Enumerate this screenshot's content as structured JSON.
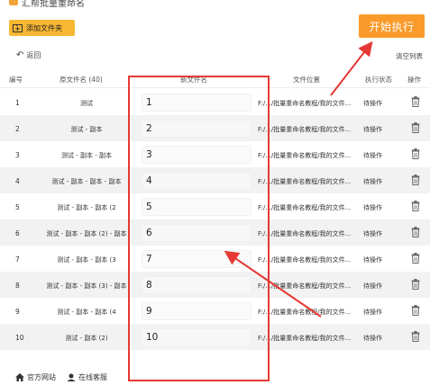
{
  "window": {
    "title": "汇帮批量重命名"
  },
  "toolbar": {
    "add_folder_label": "添加文件夹",
    "start_label": "开始执行"
  },
  "actions": {
    "undo_label": "返回",
    "clear_label": "清空列表"
  },
  "table": {
    "headers": {
      "num": "编号",
      "filename": "原文件名 (40)",
      "newname": "新文件名",
      "location": "文件位置",
      "status": "执行状态",
      "op": "操作"
    },
    "rows": [
      {
        "num": "1",
        "filename": "测试",
        "newname": "1",
        "location": "F:/.../批量重命名教程/我的文件...",
        "status": "待操作"
      },
      {
        "num": "2",
        "filename": "测试 - 副本",
        "newname": "2",
        "location": "F:/.../批量重命名教程/我的文件...",
        "status": "待操作"
      },
      {
        "num": "3",
        "filename": "测试 - 副本 - 副本",
        "newname": "3",
        "location": "F:/.../批量重命名教程/我的文件...",
        "status": "待操作"
      },
      {
        "num": "4",
        "filename": "测试 - 副本 - 副本 - 副本",
        "newname": "4",
        "location": "F:/.../批量重命名教程/我的文件...",
        "status": "待操作"
      },
      {
        "num": "5",
        "filename": "测试 - 副本 - 副本 (2",
        "newname": "5",
        "location": "F:/.../批量重命名教程/我的文件...",
        "status": "待操作"
      },
      {
        "num": "6",
        "filename": "测试 - 副本 - 副本 (2) - 副本",
        "newname": "6",
        "location": "F:/.../批量重命名教程/我的文件...",
        "status": "待操作"
      },
      {
        "num": "7",
        "filename": "测试 - 副本 - 副本 (3",
        "newname": "7",
        "location": "F:/.../批量重命名教程/我的文件...",
        "status": "待操作"
      },
      {
        "num": "8",
        "filename": "测试 - 副本 - 副本 (3) - 副本",
        "newname": "8",
        "location": "F:/.../批量重命名教程/我的文件...",
        "status": "待操作"
      },
      {
        "num": "9",
        "filename": "测试 - 副本 - 副本 (4",
        "newname": "9",
        "location": "F:/.../批量重命名教程/我的文件...",
        "status": "待操作"
      },
      {
        "num": "10",
        "filename": "测试 - 副本 (2)",
        "newname": "10",
        "location": "F:/.../批量重命名教程/我的文件...",
        "status": "待操作"
      }
    ]
  },
  "footer": {
    "website_label": "官方网站",
    "support_label": "在线客服"
  },
  "colors": {
    "accent": "#f99a2a",
    "add_button": "#f7b733",
    "annotation": "#e53935"
  }
}
